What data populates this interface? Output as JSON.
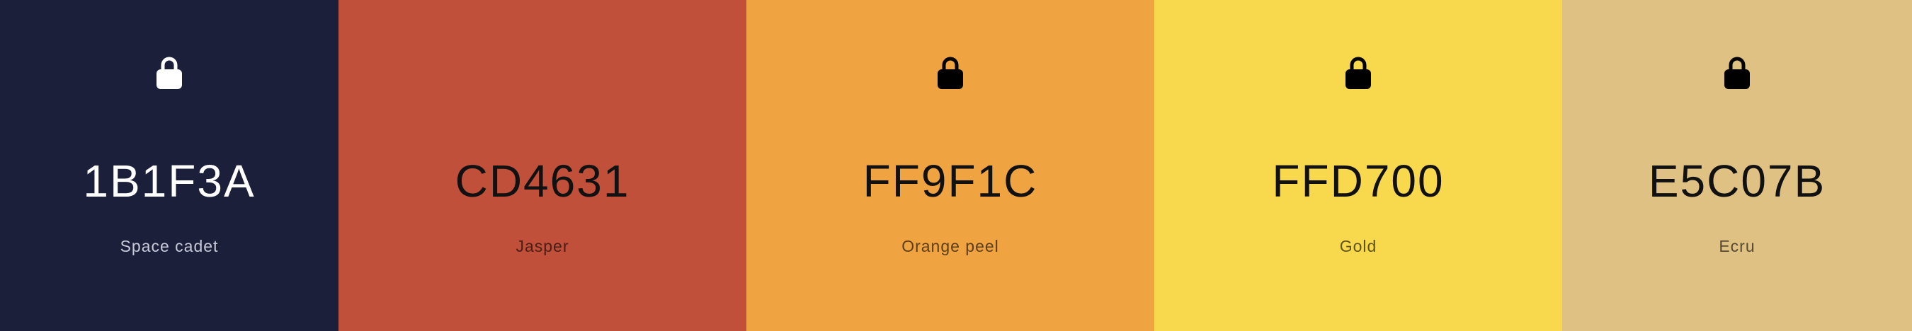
{
  "swatches": [
    {
      "hex": "1B1F3A",
      "name": "Space cadet",
      "color": "#1B1F3A",
      "text_theme": "dark",
      "icon": "lock-icon",
      "icon_visible": true
    },
    {
      "hex": "CD4631",
      "name": "Jasper",
      "color": "#C0503A",
      "text_theme": "light",
      "icon": "lock-icon",
      "icon_visible": false
    },
    {
      "hex": "FF9F1C",
      "name": "Orange peel",
      "color": "#F0A341",
      "text_theme": "light",
      "icon": "lock-icon",
      "icon_visible": true
    },
    {
      "hex": "FFD700",
      "name": "Gold",
      "color": "#F8D84C",
      "text_theme": "light",
      "icon": "lock-icon",
      "icon_visible": true
    },
    {
      "hex": "E5C07B",
      "name": "Ecru",
      "color": "#DFC183",
      "text_theme": "light",
      "icon": "lock-icon",
      "icon_visible": true
    }
  ]
}
